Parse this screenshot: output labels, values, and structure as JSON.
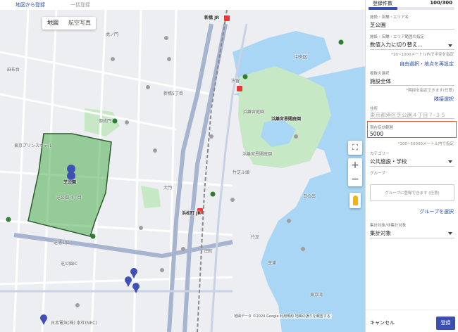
{
  "tabs": {
    "active": "地図から登録",
    "inactive": "一括登録"
  },
  "map": {
    "type_buttons": [
      "地図",
      "航空写真"
    ],
    "labels": {
      "shimbashi": "新橋 JR",
      "shiodome": "汐留",
      "hamarikyu": "浜離宮恩賜庭園",
      "hamarikyu_short": "浜離宮庭園",
      "shiba_park": "芝公園",
      "gotenyama": "御成門",
      "hamamatsucho": "浜松町 JR",
      "daimon": "大門",
      "tokyo_prince": "東京プリンスホテル",
      "takeshiba": "竹芝",
      "tamachi": "田町",
      "nec": "日本電気(株) 本社(NEC)",
      "shibaura_park": "芝浦公園",
      "chuo": "中央区",
      "tokyo_tower_area": "芝公園 4丁目",
      "hinode": "日の出",
      "shibaura": "芝浦",
      "azabudai": "麻布台",
      "toranomon": "虎ノ門",
      "shibakoen_ic": "芝公園IC",
      "port": "東京湾",
      "shimbashi5": "新橋5丁目",
      "hamarikyu_garden": "浜離宮恩賜庭園",
      "takeshiba_pier": "竹芝ふ頭"
    },
    "attribution": "地図データ ©2024 Google 利用規約 地図の誤りを報告する"
  },
  "panel": {
    "registered_label": "登録件数",
    "registered_count": "100/300",
    "progress_fraction": 0.333,
    "facility": {
      "label": "施設・店舗・エリア名",
      "value": "芝公園"
    },
    "area_spec": {
      "label": "施設・店舗・エリア範囲の指定",
      "value": "数値入力に切り替え...",
      "hint": "*10~1000メートル内で半径を指定",
      "link": "自由選択・地点を再設定"
    },
    "multi": {
      "label": "複数の選択",
      "value": "施設全体",
      "hint": "*隣接を指定できます(任意)",
      "link": "隣接選択"
    },
    "address": {
      "label": "住所",
      "value": "東京都港区芝公園４丁目７-３５"
    },
    "radius": {
      "label": "現在有効範囲",
      "value": "5000",
      "hint": "*100~50000メートル内で指定"
    },
    "category": {
      "label": "カテゴリー",
      "value": "公共施設・学校"
    },
    "group": {
      "label": "グループ",
      "placeholder": "グループに登録できます (任意)",
      "link": "グループを選択"
    },
    "aggregation": {
      "label": "集計対象/非集計対象",
      "value": "集計対象"
    },
    "footer": {
      "cancel": "キャンセル",
      "submit": "登録"
    }
  },
  "colors": {
    "accent": "#3a4fae",
    "highlight_border": "#e05b3b",
    "park_polygon": "#4caf50",
    "water": "#a9d6f5"
  }
}
